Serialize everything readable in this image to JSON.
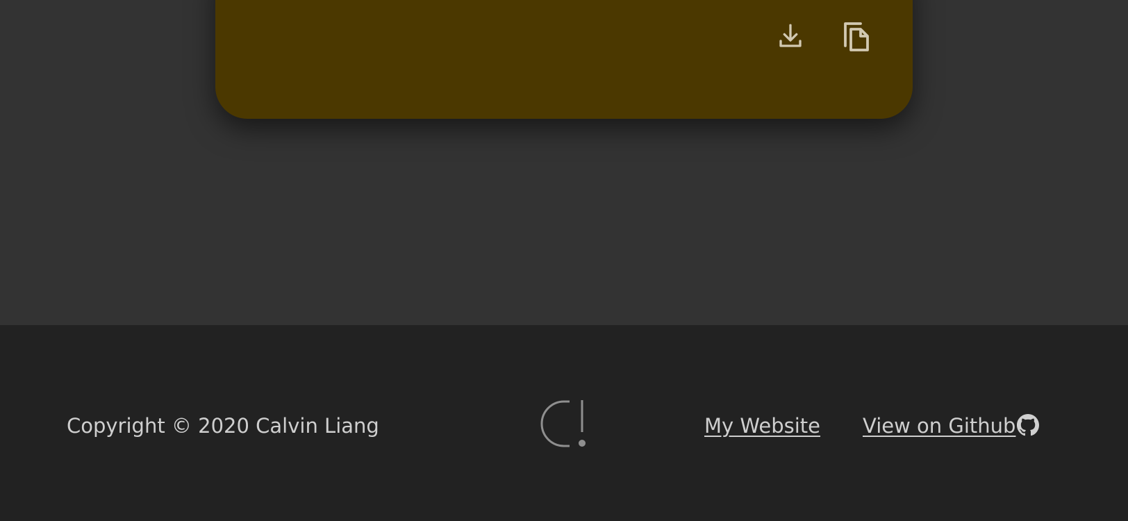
{
  "card": {
    "color": "#4b3800",
    "actions": [
      {
        "icon": "download-icon"
      },
      {
        "icon": "copy-icon"
      }
    ]
  },
  "footer": {
    "copyright": "Copyright © 2020 Calvin Liang",
    "logo_icon": "ci-logo-icon",
    "links": {
      "website": "My Website",
      "github": "View on Github",
      "github_icon": "github-icon"
    }
  },
  "colors": {
    "page_background": "#333333",
    "footer_background": "#222222",
    "text": "#cfcfcf",
    "icon": "#d2c9b2"
  }
}
